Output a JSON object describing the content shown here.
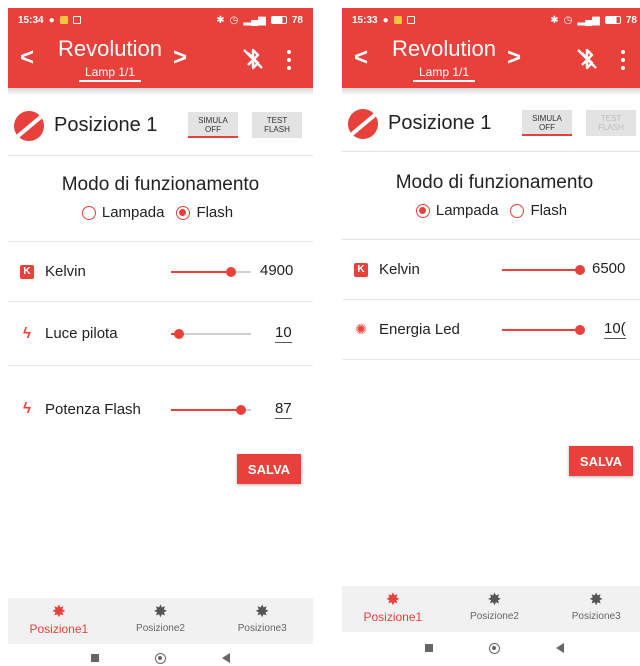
{
  "colors": {
    "accent": "#e8403a",
    "inactive": "#666666"
  },
  "screen_a": {
    "status": {
      "time": "15:34",
      "battery": "78"
    },
    "appbar": {
      "prev": "<",
      "title": "Revolution",
      "subtitle": "Lamp 1/1",
      "next": ">",
      "bt_icon": "bluetooth-off-icon",
      "menu_icon": "more-vert-icon"
    },
    "position": {
      "title": "Posizione 1",
      "simula_line1": "SIMULA",
      "simula_line2": "OFF",
      "test_line1": "TEST",
      "test_line2": "FLASH"
    },
    "mode": {
      "title": "Modo di funzionamento",
      "option1": "Lampada",
      "option2": "Flash",
      "selected": "Flash"
    },
    "params": [
      {
        "label": "Kelvin",
        "icon": "kelvin-icon",
        "value": "4900",
        "slider_fraction": 0.75
      },
      {
        "label": "Luce pilota",
        "icon": "bolt-icon",
        "value": "10",
        "slider_fraction": 0.1
      },
      {
        "label": "Potenza Flash",
        "icon": "bolt-icon",
        "value": "87",
        "slider_fraction": 0.87
      }
    ],
    "save": "SALVA",
    "bottom_nav": [
      {
        "label": "Posizione1",
        "icon": "gear-icon",
        "active": true
      },
      {
        "label": "Posizione2",
        "icon": "gear-icon",
        "active": false
      },
      {
        "label": "Posizione3",
        "icon": "gear-icon",
        "active": false
      }
    ]
  },
  "screen_b": {
    "status": {
      "time": "15:33",
      "battery": "78"
    },
    "appbar": {
      "prev": "<",
      "title": "Revolution",
      "subtitle": "Lamp 1/1",
      "next": ">",
      "bt_icon": "bluetooth-off-icon",
      "menu_icon": "more-vert-icon"
    },
    "position": {
      "title": "Posizione 1",
      "simula_line1": "SIMULA",
      "simula_line2": "OFF",
      "test_line1": "TEST",
      "test_line2": "FLASH",
      "test_disabled": true
    },
    "mode": {
      "title": "Modo di funzionamento",
      "option1": "Lampada",
      "option2": "Flash",
      "selected": "Lampada"
    },
    "params": [
      {
        "label": "Kelvin",
        "icon": "kelvin-icon",
        "value": "6500",
        "slider_fraction": 1.0
      },
      {
        "label": "Energia Led",
        "icon": "led-icon",
        "value": "10(",
        "slider_fraction": 1.0
      }
    ],
    "save": "SALVA",
    "bottom_nav": [
      {
        "label": "Posizione1",
        "icon": "gear-icon",
        "active": true
      },
      {
        "label": "Posizione2",
        "icon": "gear-icon",
        "active": false
      },
      {
        "label": "Posizione3",
        "icon": "gear-icon",
        "active": false
      }
    ]
  }
}
